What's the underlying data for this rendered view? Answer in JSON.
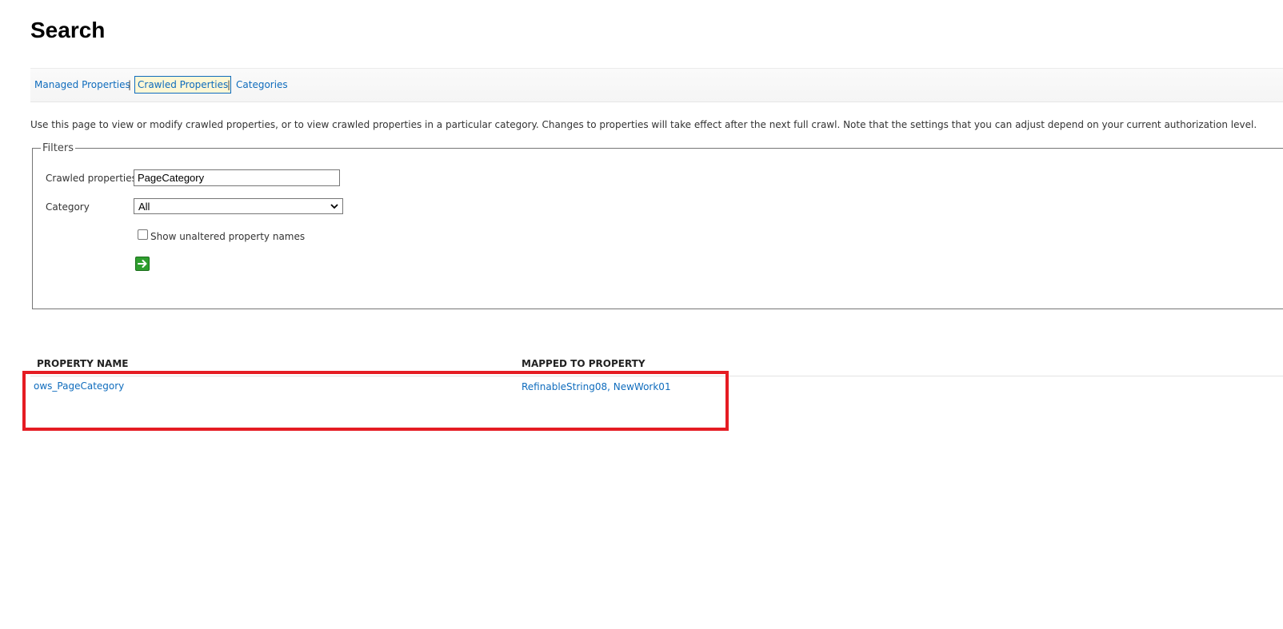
{
  "page": {
    "title": "Search"
  },
  "tabs": {
    "items": [
      {
        "label": "Managed Properties",
        "active": false
      },
      {
        "label": "Crawled Properties",
        "active": true
      },
      {
        "label": "Categories",
        "active": false
      }
    ],
    "separator": "|"
  },
  "description": "Use this page to view or modify crawled properties, or to view crawled properties in a particular category. Changes to properties will take effect after the next full crawl. Note that the settings that you can adjust depend on your current authorization level.",
  "filters": {
    "legend": "Filters",
    "crawled_properties_label": "Crawled properties",
    "crawled_properties_value": "PageCategory",
    "category_label": "Category",
    "category_value": "All",
    "show_unaltered_label": "Show unaltered property names",
    "show_unaltered_checked": false,
    "go_icon": "green-arrow-right-icon"
  },
  "results": {
    "columns": [
      "PROPERTY NAME",
      "MAPPED TO PROPERTY"
    ],
    "rows": [
      {
        "property_name": "ows_PageCategory",
        "mapped_to": "RefinableString08, NewWork01"
      }
    ]
  },
  "colors": {
    "link": "#0f6cbd",
    "active_tab_bg": "#fdf7d6",
    "highlight": "#e51c23",
    "go_button": "#2e9e2e"
  }
}
